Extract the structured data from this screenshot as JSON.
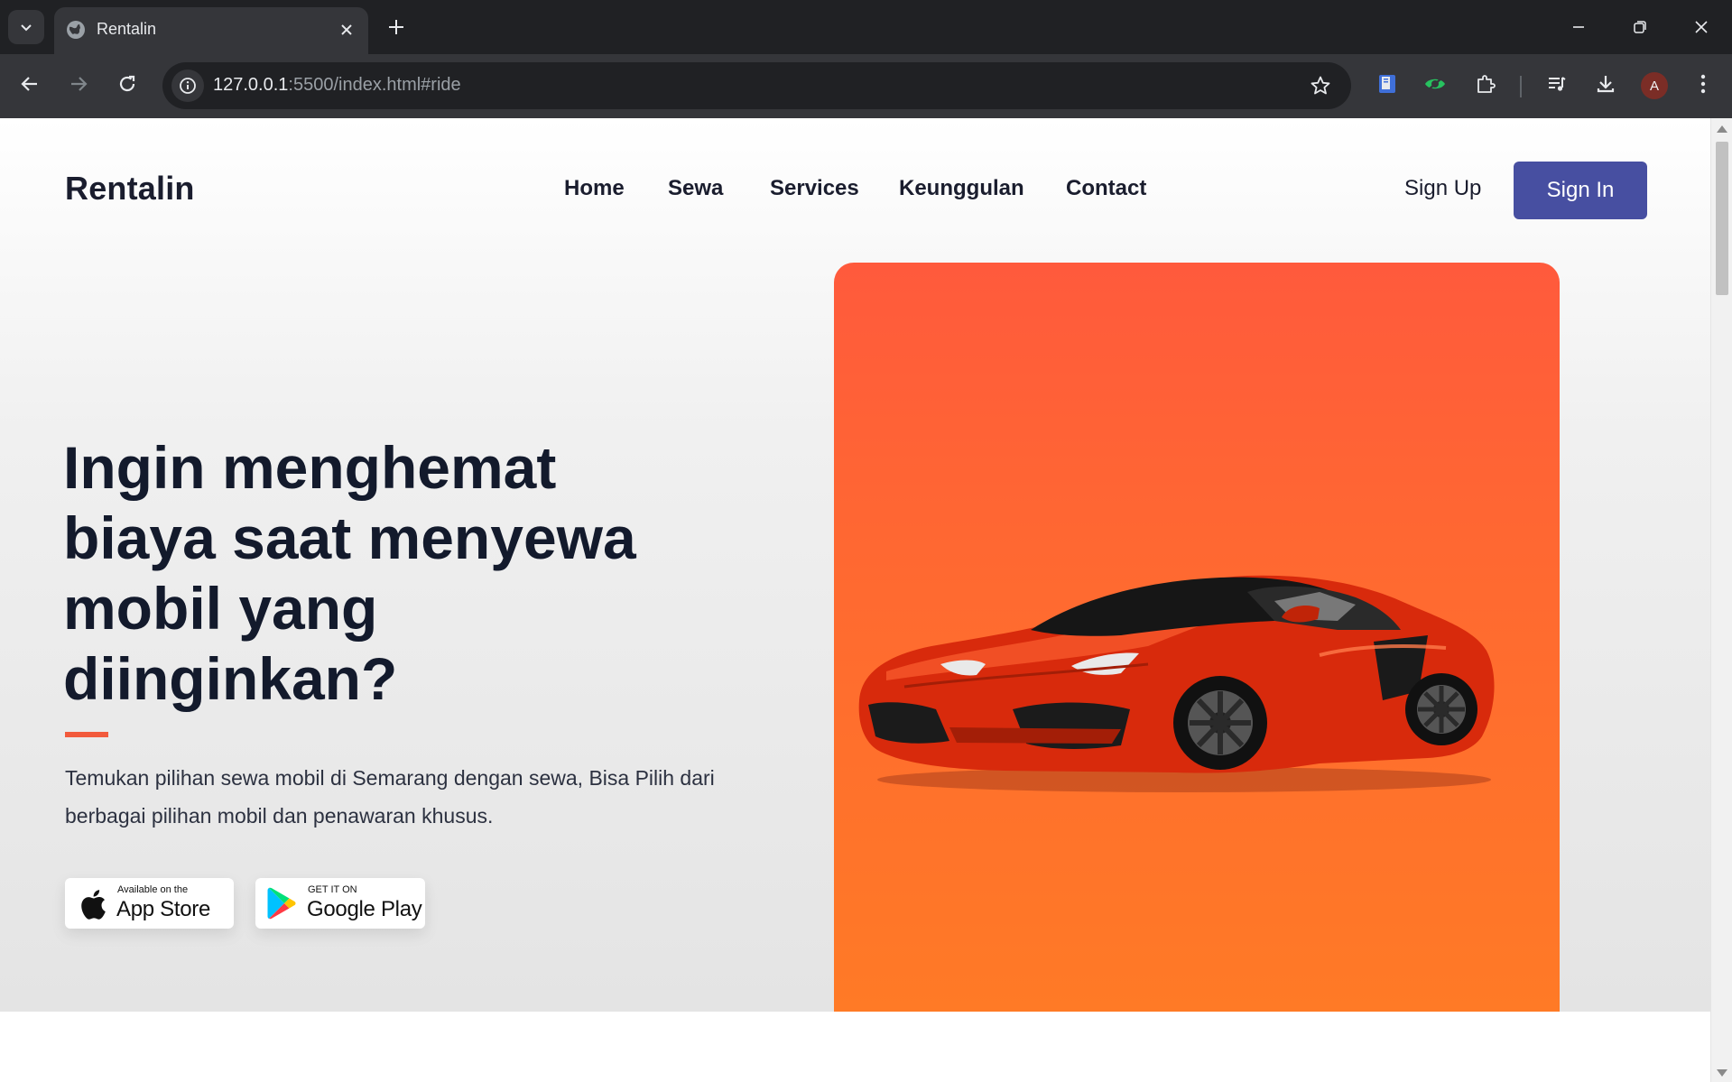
{
  "browser": {
    "tab_title": "Rentalin",
    "url_host": "127.0.0.1",
    "url_rest": ":5500/index.html#ride",
    "profile_initial": "A"
  },
  "site": {
    "brand": "Rentalin",
    "nav": [
      "Home",
      "Sewa",
      "Services",
      "Keunggulan",
      "Contact"
    ],
    "sign_up": "Sign Up",
    "sign_in": "Sign In",
    "headline": "Ingin menghemat biaya saat menyewa mobil yang diinginkan?",
    "description": "Temukan pilihan sewa mobil di Semarang dengan sewa, Bisa Pilih dari berbagai pilihan mobil dan penawaran khusus.",
    "app_store": {
      "small": "Available on the",
      "big": "App Store"
    },
    "google_play": {
      "small": "GET IT ON",
      "big": "Google Play"
    }
  },
  "colors": {
    "accent_button": "#474fa1",
    "accent_line": "#f25a3c",
    "card_top": "#ff5a3c",
    "card_bottom": "#ff7d24"
  }
}
